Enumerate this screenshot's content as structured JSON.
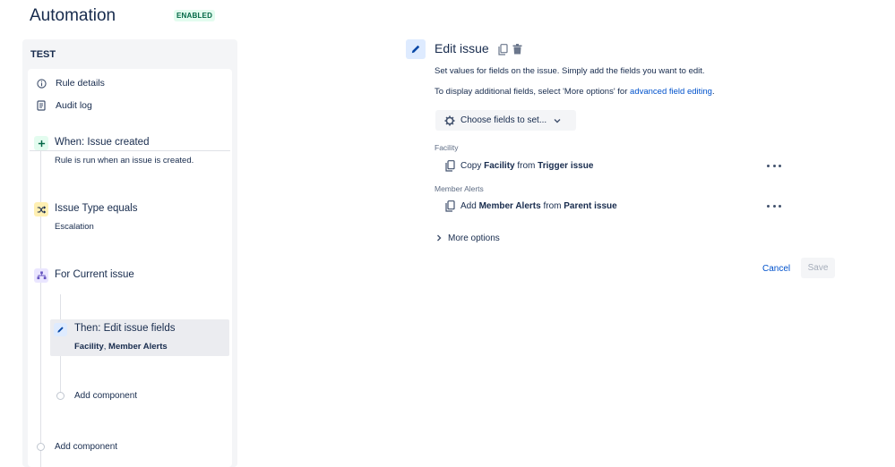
{
  "header": {
    "title": "Automation",
    "status_badge": "ENABLED"
  },
  "sidebar": {
    "rule_name": "TEST",
    "links": [
      {
        "label": "Rule details",
        "icon": "info-icon"
      },
      {
        "label": "Audit log",
        "icon": "document-icon"
      }
    ],
    "components": [
      {
        "title": "When: Issue created",
        "subtitle": "Rule is run when an issue is created.",
        "icon": "plus-icon",
        "color": "#36b37e"
      },
      {
        "title": "Issue Type equals",
        "subtitle": "Escalation",
        "icon": "shuffle-icon",
        "color": "#ffab00"
      },
      {
        "title": "For Current issue",
        "icon": "hierarchy-icon",
        "color": "#6554c0"
      }
    ],
    "nested_action": {
      "title": "Then: Edit issue fields",
      "fields": [
        "Facility",
        "Member Alerts"
      ],
      "separator": ", "
    },
    "add_component_inner": "Add component",
    "add_component_outer": "Add component"
  },
  "main": {
    "title": "Edit issue",
    "description": "Set values for fields on the issue. Simply add the fields you want to edit.",
    "description2_prefix": "To display additional fields, select 'More options' for ",
    "description2_link": "advanced field editing",
    "description2_suffix": ".",
    "choose_fields_label": "Choose fields to set...",
    "fields": [
      {
        "label": "Facility",
        "verb": "Copy",
        "field": "Facility",
        "from": "from",
        "source": "Trigger issue"
      },
      {
        "label": "Member Alerts",
        "verb": "Add",
        "field": "Member Alerts",
        "from": "from",
        "source": "Parent issue"
      }
    ],
    "more_options_label": "More options",
    "cancel_label": "Cancel",
    "save_label": "Save"
  },
  "colors": {
    "accent": "#0052cc",
    "text": "#172b4d",
    "enabled_badge_bg": "#e3fcef",
    "enabled_badge_text": "#006644"
  }
}
